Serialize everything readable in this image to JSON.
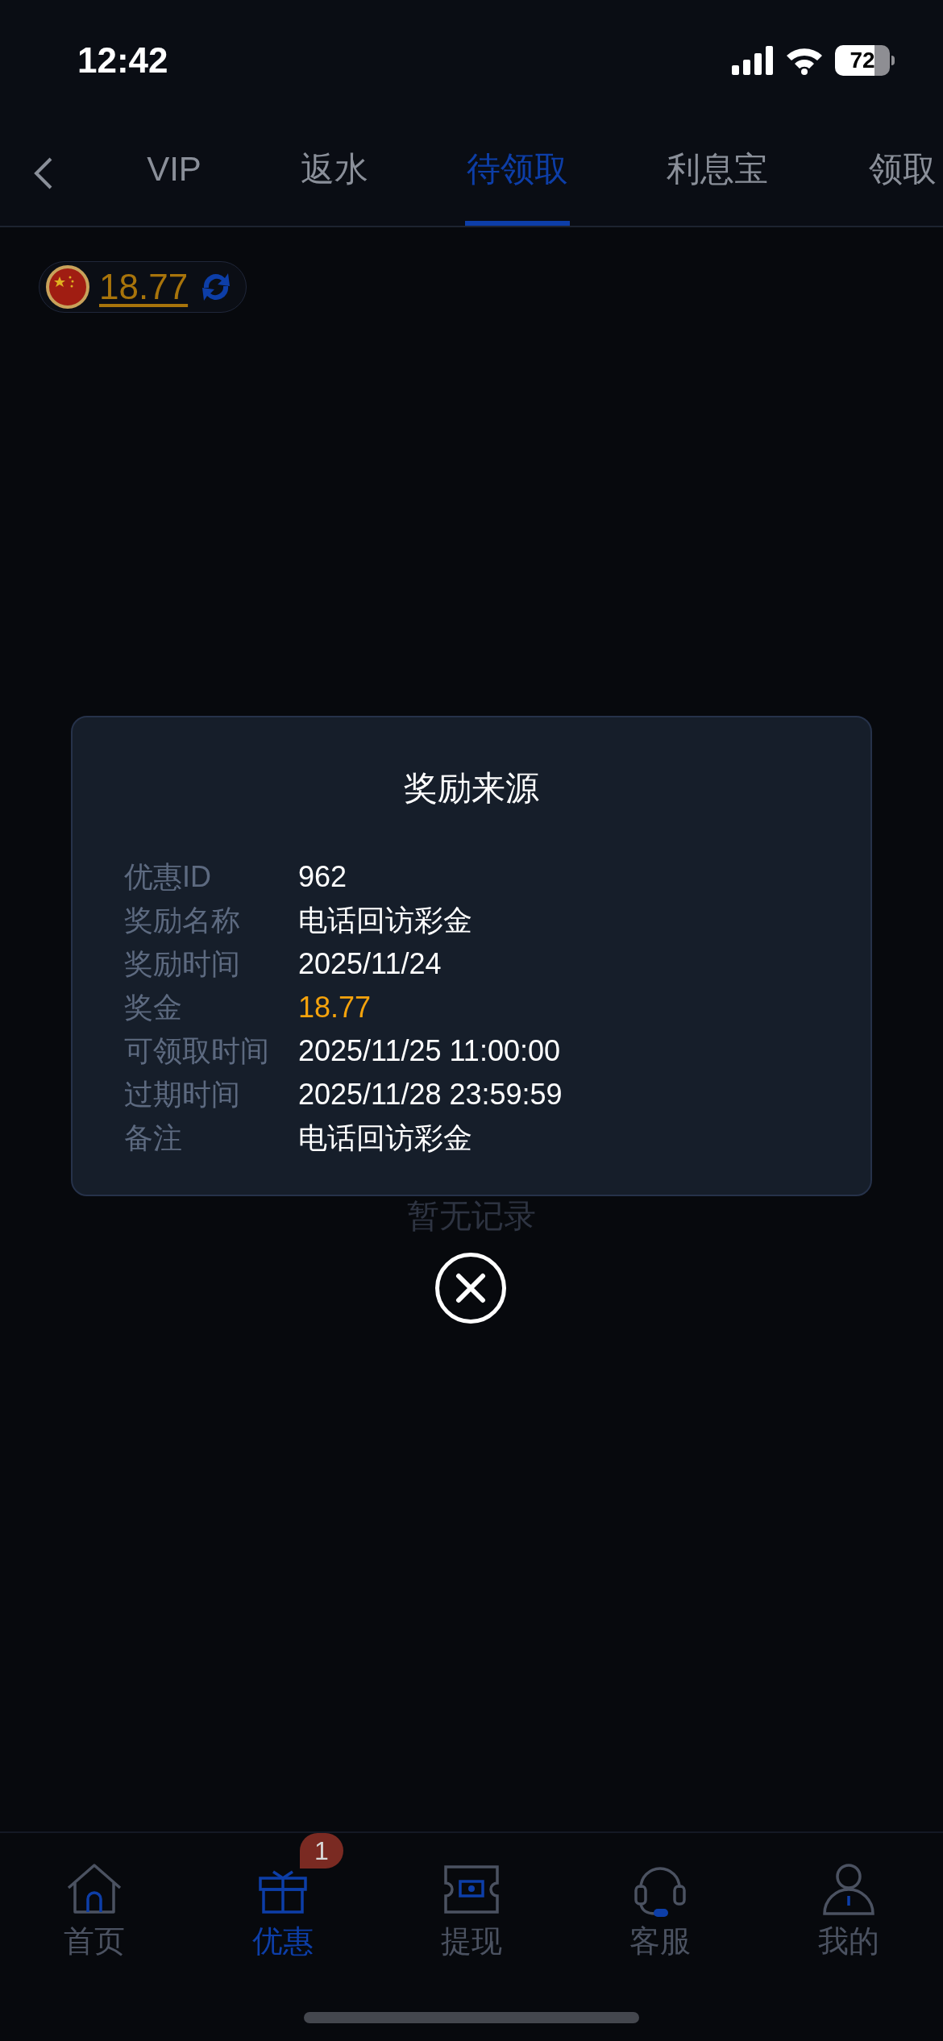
{
  "status_bar": {
    "time": "12:42",
    "battery": "72"
  },
  "tabs": [
    {
      "label": "VIP",
      "selected": false
    },
    {
      "label": "返水",
      "selected": false
    },
    {
      "label": "待领取",
      "selected": true
    },
    {
      "label": "利息宝",
      "selected": false
    },
    {
      "label": "领取",
      "selected": false
    }
  ],
  "balance": {
    "amount": "18.77"
  },
  "empty_text": "暂无记录",
  "dialog": {
    "title": "奖励来源",
    "rows": [
      {
        "label": "优惠ID",
        "value": "962",
        "highlight": false
      },
      {
        "label": "奖励名称",
        "value": "电话回访彩金",
        "highlight": false
      },
      {
        "label": "奖励时间",
        "value": "2025/11/24",
        "highlight": false
      },
      {
        "label": "奖金",
        "value": "18.77",
        "highlight": true
      },
      {
        "label": "可领取时间",
        "value": "2025/11/25 11:00:00",
        "highlight": false
      },
      {
        "label": "过期时间",
        "value": "2025/11/28 23:59:59",
        "highlight": false
      },
      {
        "label": "备注",
        "value": "电话回访彩金",
        "highlight": false
      }
    ]
  },
  "bottom_nav": [
    {
      "kind": "home",
      "label": "首页",
      "selected": false
    },
    {
      "kind": "gift",
      "label": "优惠",
      "selected": true,
      "badge": "1"
    },
    {
      "kind": "withdraw",
      "label": "提现",
      "selected": false
    },
    {
      "kind": "support",
      "label": "客服",
      "selected": false
    },
    {
      "kind": "profile",
      "label": "我的",
      "selected": false
    }
  ]
}
